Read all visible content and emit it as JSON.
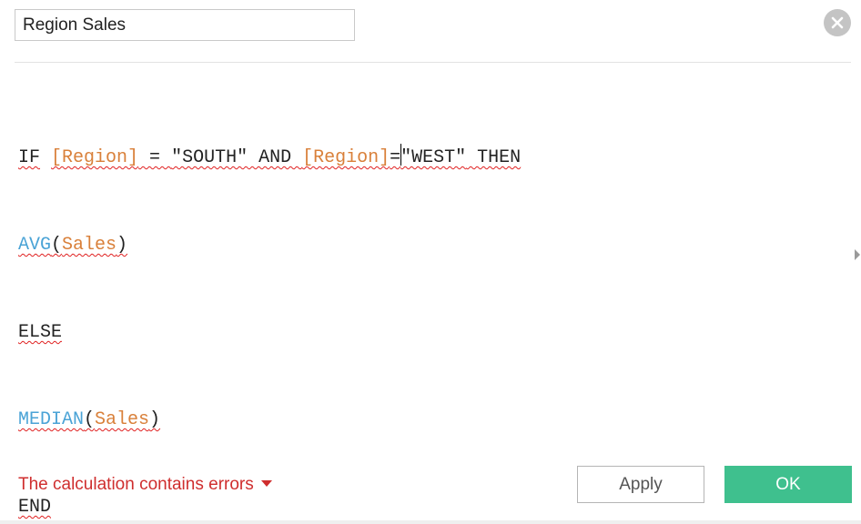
{
  "calc_name": "Region Sales",
  "icons": {
    "close": "close-icon",
    "expand": "expand-arrow-icon",
    "dropdown": "chevron-down-icon"
  },
  "colors": {
    "keyword": "#222222",
    "field": "#d9803a",
    "function": "#4aa3d6",
    "error": "#cf2e2e",
    "ok": "#3fc08e",
    "squiggle": "#e02020"
  },
  "formula": {
    "line1": {
      "if": "IF",
      "sp1": " ",
      "field1": "[Region]",
      "eq1": " = ",
      "str1": "\"SOUTH\"",
      "and": " AND ",
      "field2": "[Region]",
      "eq2": "=",
      "str2": "\"WEST\"",
      "then": " THEN"
    },
    "line2": {
      "fn": "AVG",
      "open": "(",
      "arg": "Sales",
      "close": ")"
    },
    "line3": {
      "kw": "ELSE"
    },
    "line4": {
      "fn": "MEDIAN",
      "open": "(",
      "arg": "Sales",
      "close": ")"
    },
    "line5": {
      "kw": "END"
    }
  },
  "status": {
    "error_text": "The calculation contains errors"
  },
  "buttons": {
    "apply": "Apply",
    "ok": "OK"
  }
}
